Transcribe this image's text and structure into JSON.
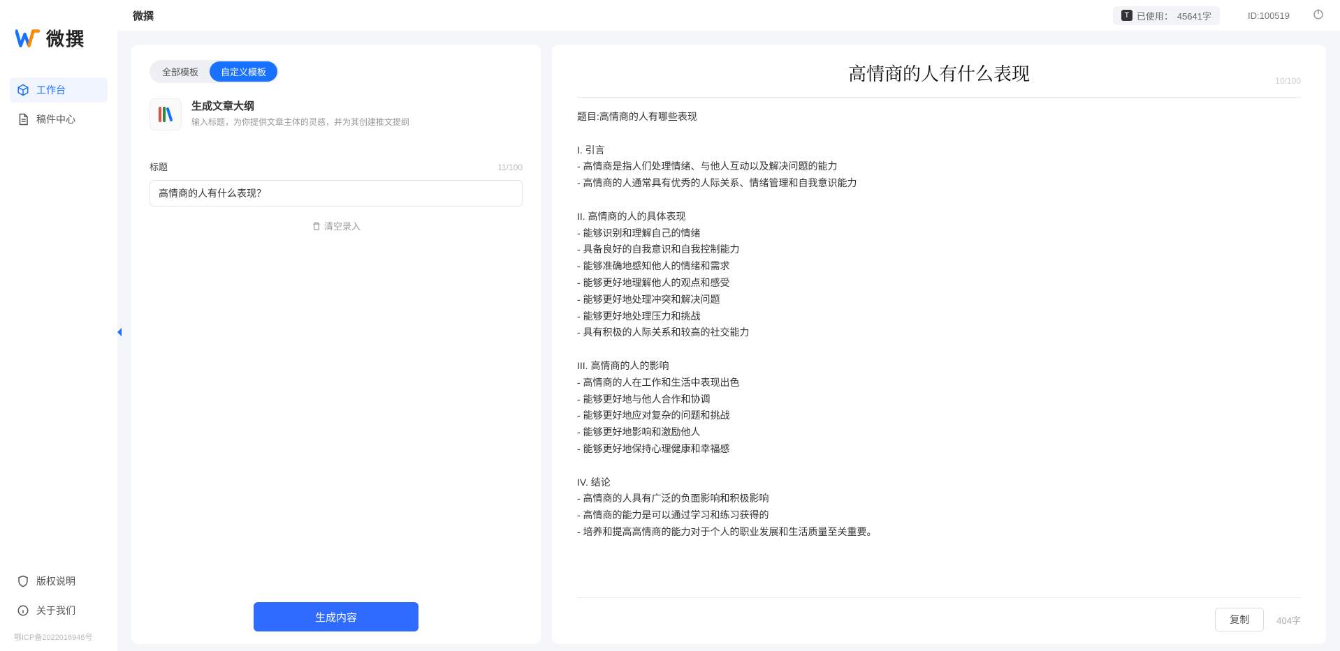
{
  "brand": {
    "name": "微撰"
  },
  "topbar": {
    "title": "微撰",
    "usage_label": "已使用：",
    "usage_value": "45641字",
    "id_label": "ID:100519"
  },
  "sidebar": {
    "items": [
      {
        "label": "工作台",
        "icon": "cube-icon",
        "active": true
      },
      {
        "label": "稿件中心",
        "icon": "document-icon",
        "active": false
      }
    ],
    "footer": [
      {
        "label": "版权说明",
        "icon": "shield-icon"
      },
      {
        "label": "关于我们",
        "icon": "info-icon"
      }
    ],
    "icp": "鄂ICP备2022016946号"
  },
  "left": {
    "tabs": [
      {
        "label": "全部模板",
        "active": false
      },
      {
        "label": "自定义模板",
        "active": true
      }
    ],
    "template": {
      "title": "生成文章大纲",
      "desc": "输入标题，为你提供文章主体的灵感，并为其创建推文提纲"
    },
    "field": {
      "label": "标题",
      "count": "11/100",
      "value": "高情商的人有什么表现？"
    },
    "clear_label": "清空录入",
    "generate": "生成内容"
  },
  "right": {
    "title": "高情商的人有什么表现",
    "title_count": "10/100",
    "body": "题目:高情商的人有哪些表现\n\nI. 引言\n- 高情商是指人们处理情绪、与他人互动以及解决问题的能力\n- 高情商的人通常具有优秀的人际关系、情绪管理和自我意识能力\n\nII. 高情商的人的具体表现\n- 能够识别和理解自己的情绪\n- 具备良好的自我意识和自我控制能力\n- 能够准确地感知他人的情绪和需求\n- 能够更好地理解他人的观点和感受\n- 能够更好地处理冲突和解决问题\n- 能够更好地处理压力和挑战\n- 具有积极的人际关系和较高的社交能力\n\nIII. 高情商的人的影响\n- 高情商的人在工作和生活中表现出色\n- 能够更好地与他人合作和协调\n- 能够更好地应对复杂的问题和挑战\n- 能够更好地影响和激励他人\n- 能够更好地保持心理健康和幸福感\n\nIV. 结论\n- 高情商的人具有广泛的负面影响和积极影响\n- 高情商的能力是可以通过学习和练习获得的\n- 培养和提高高情商的能力对于个人的职业发展和生活质量至关重要。",
    "copy": "复制",
    "word_count": "404字"
  }
}
